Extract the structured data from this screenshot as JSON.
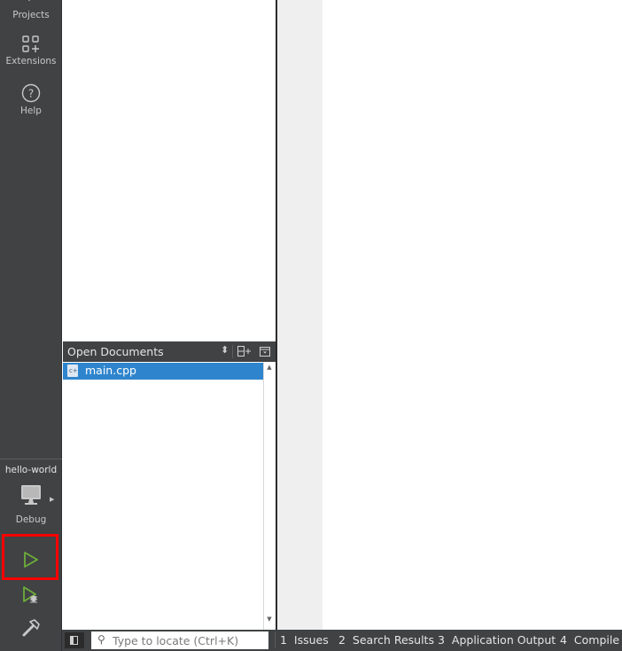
{
  "modebar": {
    "items": [
      {
        "label": "Projects",
        "icon": "wrench-icon"
      },
      {
        "label": "Extensions",
        "icon": "extensions-icon"
      },
      {
        "label": "Help",
        "icon": "help-icon"
      }
    ],
    "project_name": "hello-world",
    "build_config": "Debug",
    "run_icon": "run-icon",
    "debug_icon": "debug-run-icon",
    "build_icon": "hammer-icon",
    "highlight_color": "#ff0000"
  },
  "navigation": {
    "title": "Open Documents",
    "documents": [
      {
        "name": "main.cpp",
        "selected": true
      }
    ],
    "selection_color": "#2f85cd"
  },
  "statusbar": {
    "locator_placeholder": "Type to locate (Ctrl+K)",
    "output_panes": [
      {
        "num": "1",
        "label": "Issues"
      },
      {
        "num": "2",
        "label": "Search Results"
      },
      {
        "num": "3",
        "label": "Application Output"
      },
      {
        "num": "4",
        "label": "Compile Output"
      }
    ]
  }
}
